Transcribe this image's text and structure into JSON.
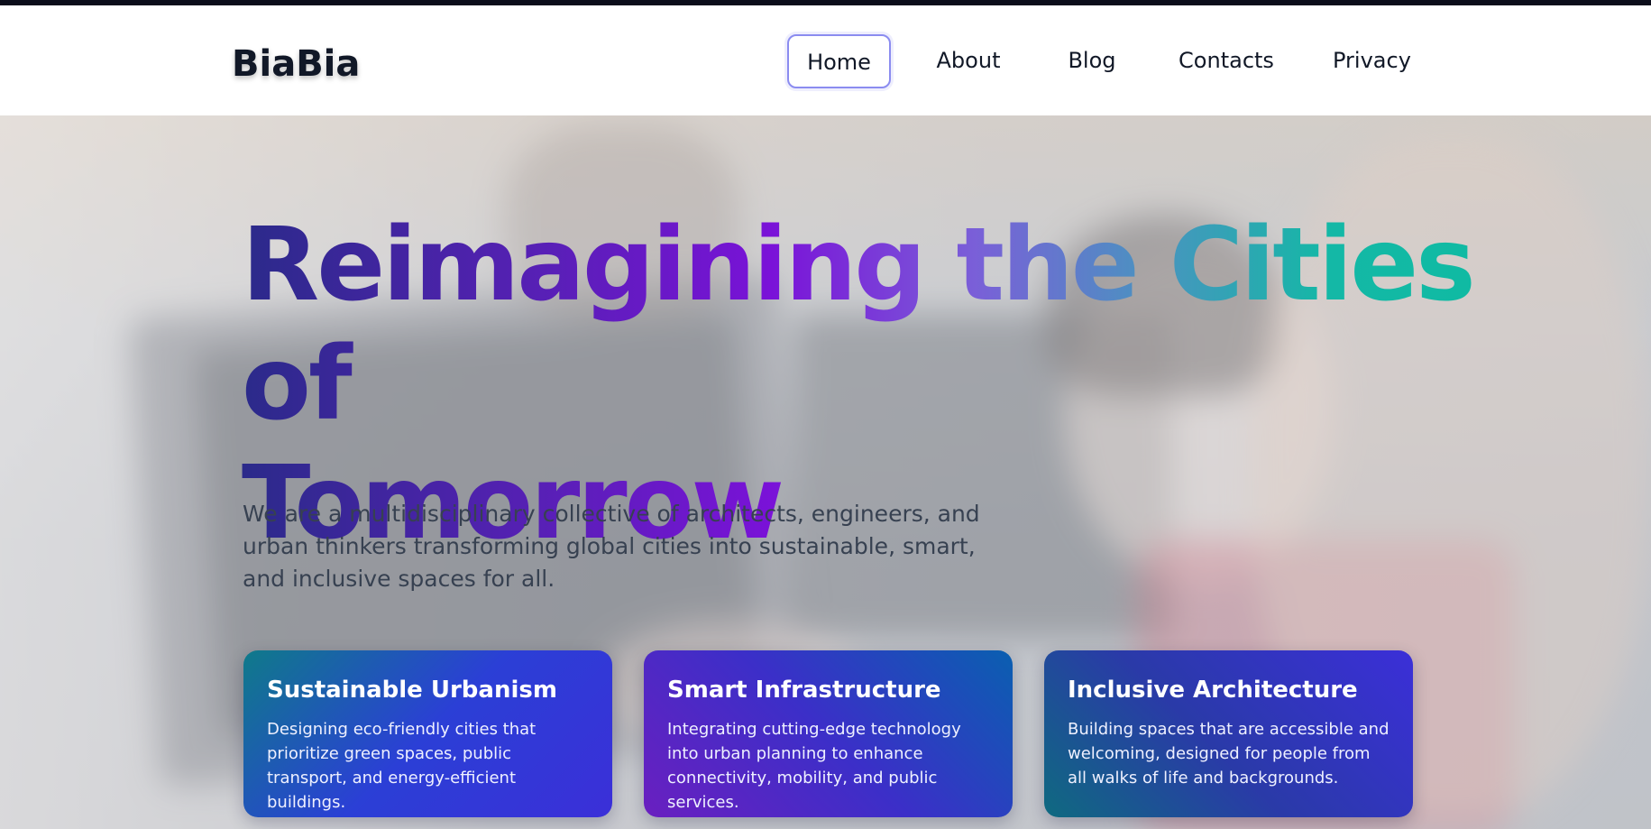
{
  "brand": {
    "name": "BiaBia"
  },
  "nav": {
    "items": [
      {
        "label": "Home",
        "active": true
      },
      {
        "label": "About",
        "active": false
      },
      {
        "label": "Blog",
        "active": false
      },
      {
        "label": "Contacts",
        "active": false
      },
      {
        "label": "Privacy",
        "active": false
      }
    ]
  },
  "hero": {
    "headline_line1": "Reimagining the Cities of",
    "headline_line2": "Tomorrow",
    "subtitle": "We are a multidisciplinary collective of architects, engineers, and urban thinkers transforming global cities into sustainable, smart, and inclusive spaces for all."
  },
  "cards": [
    {
      "title": "Sustainable Urbanism",
      "text": "Designing eco-friendly cities that prioritize green spaces, public transport, and energy-efficient buildings."
    },
    {
      "title": "Smart Infrastructure",
      "text": "Integrating cutting-edge technology into urban planning to enhance connectivity, mobility, and public services."
    },
    {
      "title": "Inclusive Architecture",
      "text": "Building spaces that are accessible and welcoming, designed for people from all walks of life and backgrounds."
    }
  ],
  "colors": {
    "nav_active_border": "#8b8cf0",
    "text_dark": "#111827",
    "card1_gradient": [
      "#0f7a8a",
      "#2b3fd6",
      "#3b2fd8"
    ],
    "card2_gradient": [
      "#0a5fb0",
      "#3b2fc8",
      "#6a1fc0"
    ],
    "card3_gradient": [
      "#3b2fd8",
      "#2a3aa8",
      "#0f6a80"
    ]
  }
}
